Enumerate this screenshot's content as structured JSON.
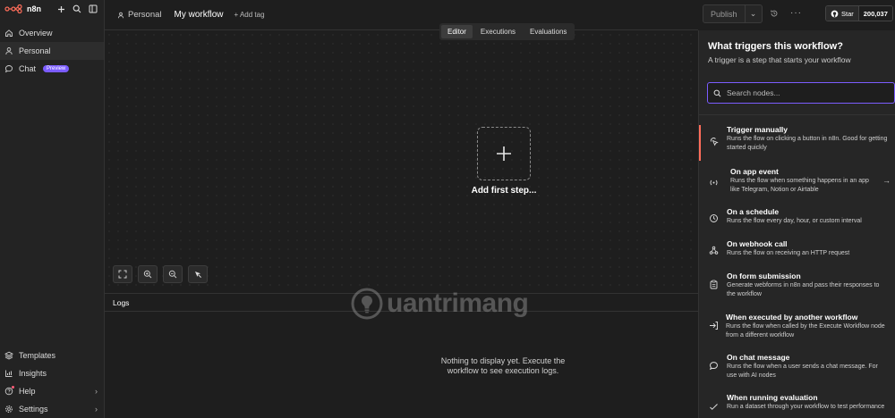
{
  "app": {
    "logo_text": "n8n"
  },
  "sidebar": {
    "top_items": [
      {
        "label": "Overview",
        "icon": "home-icon"
      },
      {
        "label": "Personal",
        "icon": "user-icon"
      },
      {
        "label": "Chat",
        "icon": "chat-icon",
        "badge": "Preview"
      }
    ],
    "bottom_items": [
      {
        "label": "Templates",
        "icon": "templates-icon"
      },
      {
        "label": "Insights",
        "icon": "chart-icon"
      },
      {
        "label": "Help",
        "icon": "help-icon"
      },
      {
        "label": "Settings",
        "icon": "gear-icon"
      }
    ]
  },
  "header": {
    "breadcrumb": "Personal",
    "workflow_name": "My workflow",
    "add_tag": "+ Add tag",
    "publish_label": "Publish",
    "github_star": "Star",
    "github_count": "200,037"
  },
  "canvas": {
    "tabs": [
      {
        "label": "Editor",
        "active": true
      },
      {
        "label": "Executions",
        "active": false
      },
      {
        "label": "Evaluations",
        "active": false
      }
    ],
    "add_first_step": "Add first step..."
  },
  "logs": {
    "title": "Logs",
    "empty_line1": "Nothing to display yet. Execute the",
    "empty_line2": "workflow to see execution logs."
  },
  "watermark": {
    "text": "uantrimang"
  },
  "trigger_panel": {
    "title": "What triggers this workflow?",
    "subtitle": "A trigger is a step that starts your workflow",
    "search_placeholder": "Search nodes...",
    "items": [
      {
        "title": "Trigger manually",
        "desc": "Runs the flow on clicking a button in n8n. Good for getting started quickly",
        "icon": "cursor-click-icon"
      },
      {
        "title": "On app event",
        "desc": "Runs the flow when something happens in an app like Telegram, Notion or Airtable",
        "icon": "radio-waves-icon"
      },
      {
        "title": "On a schedule",
        "desc": "Runs the flow every day, hour, or custom interval",
        "icon": "clock-icon"
      },
      {
        "title": "On webhook call",
        "desc": "Runs the flow on receiving an HTTP request",
        "icon": "webhook-icon"
      },
      {
        "title": "On form submission",
        "desc": "Generate webforms in n8n and pass their responses to the workflow",
        "icon": "clipboard-icon"
      },
      {
        "title": "When executed by another workflow",
        "desc": "Runs the flow when called by the Execute Workflow node from a different workflow",
        "icon": "sign-in-icon"
      },
      {
        "title": "On chat message",
        "desc": "Runs the flow when a user sends a chat message. For use with AI nodes",
        "icon": "chat-icon"
      },
      {
        "title": "When running evaluation",
        "desc": "Run a dataset through your workflow to test performance",
        "icon": "check-icon"
      }
    ]
  },
  "colors": {
    "accent": "#7b5cff",
    "trigger_accent": "#ff6d5a",
    "background": "#1e1e1e"
  }
}
